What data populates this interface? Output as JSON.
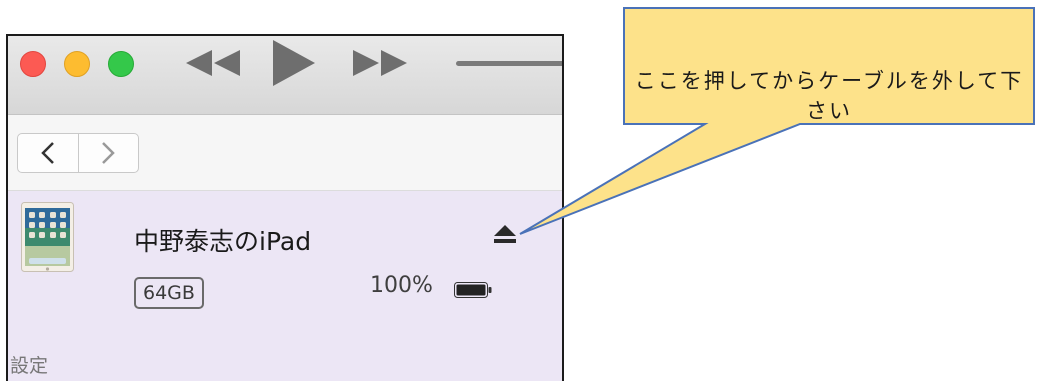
{
  "callout": {
    "text": "ここを押してからケーブルを外して下さい"
  },
  "window": {
    "controls": {
      "traffic_lights": [
        "close-button",
        "minimize-button",
        "zoom-button"
      ],
      "playback": [
        "rewind-icon",
        "play-icon",
        "fast-forward-icon"
      ]
    },
    "nav": {
      "back": "‹",
      "forward": "›"
    }
  },
  "device": {
    "name": "中野泰志のiPad",
    "capacity": "64GB",
    "battery_percent": "100%",
    "battery_level": 1.0
  },
  "section": {
    "settings": "設定"
  },
  "colors": {
    "callout_fill": "#fde28a",
    "callout_stroke": "#4a72b8",
    "device_row_bg": "#ece6f5"
  }
}
